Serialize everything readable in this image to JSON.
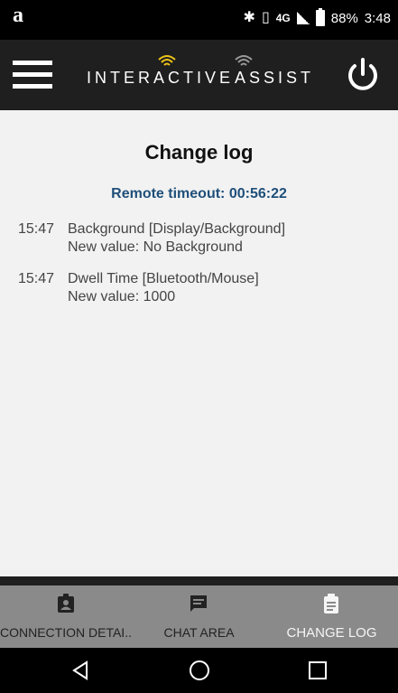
{
  "status_bar": {
    "carrier_logo": "a",
    "bluetooth_icon": "∦",
    "vibrate_icon": "▯",
    "network": "4G",
    "battery_percent": "88%",
    "time": "3:48"
  },
  "header": {
    "brand_word_1": "INTERACTIVE",
    "brand_word_2": "ASSIST",
    "brand_accent_color": "#f0c419"
  },
  "main": {
    "title": "Change log",
    "timeout_text": "Remote timeout: 00:56:22",
    "entries": [
      {
        "time": "15:47",
        "setting": "Background [Display/Background]",
        "value": "New value: No Background"
      },
      {
        "time": "15:47",
        "setting": "Dwell Time [Bluetooth/Mouse]",
        "value": "New value: 1000"
      }
    ]
  },
  "tabs": [
    {
      "label": "CONNECTION DETAI...",
      "icon": "id-badge-icon",
      "active": false
    },
    {
      "label": "CHAT AREA",
      "icon": "chat-icon",
      "active": false
    },
    {
      "label": "CHANGE LOG",
      "icon": "clipboard-icon",
      "active": true
    }
  ],
  "colors": {
    "header_bg": "#1f1f1f",
    "timeout_text": "#1f4f7a",
    "tab_bar_bg": "#8a8a8a"
  }
}
